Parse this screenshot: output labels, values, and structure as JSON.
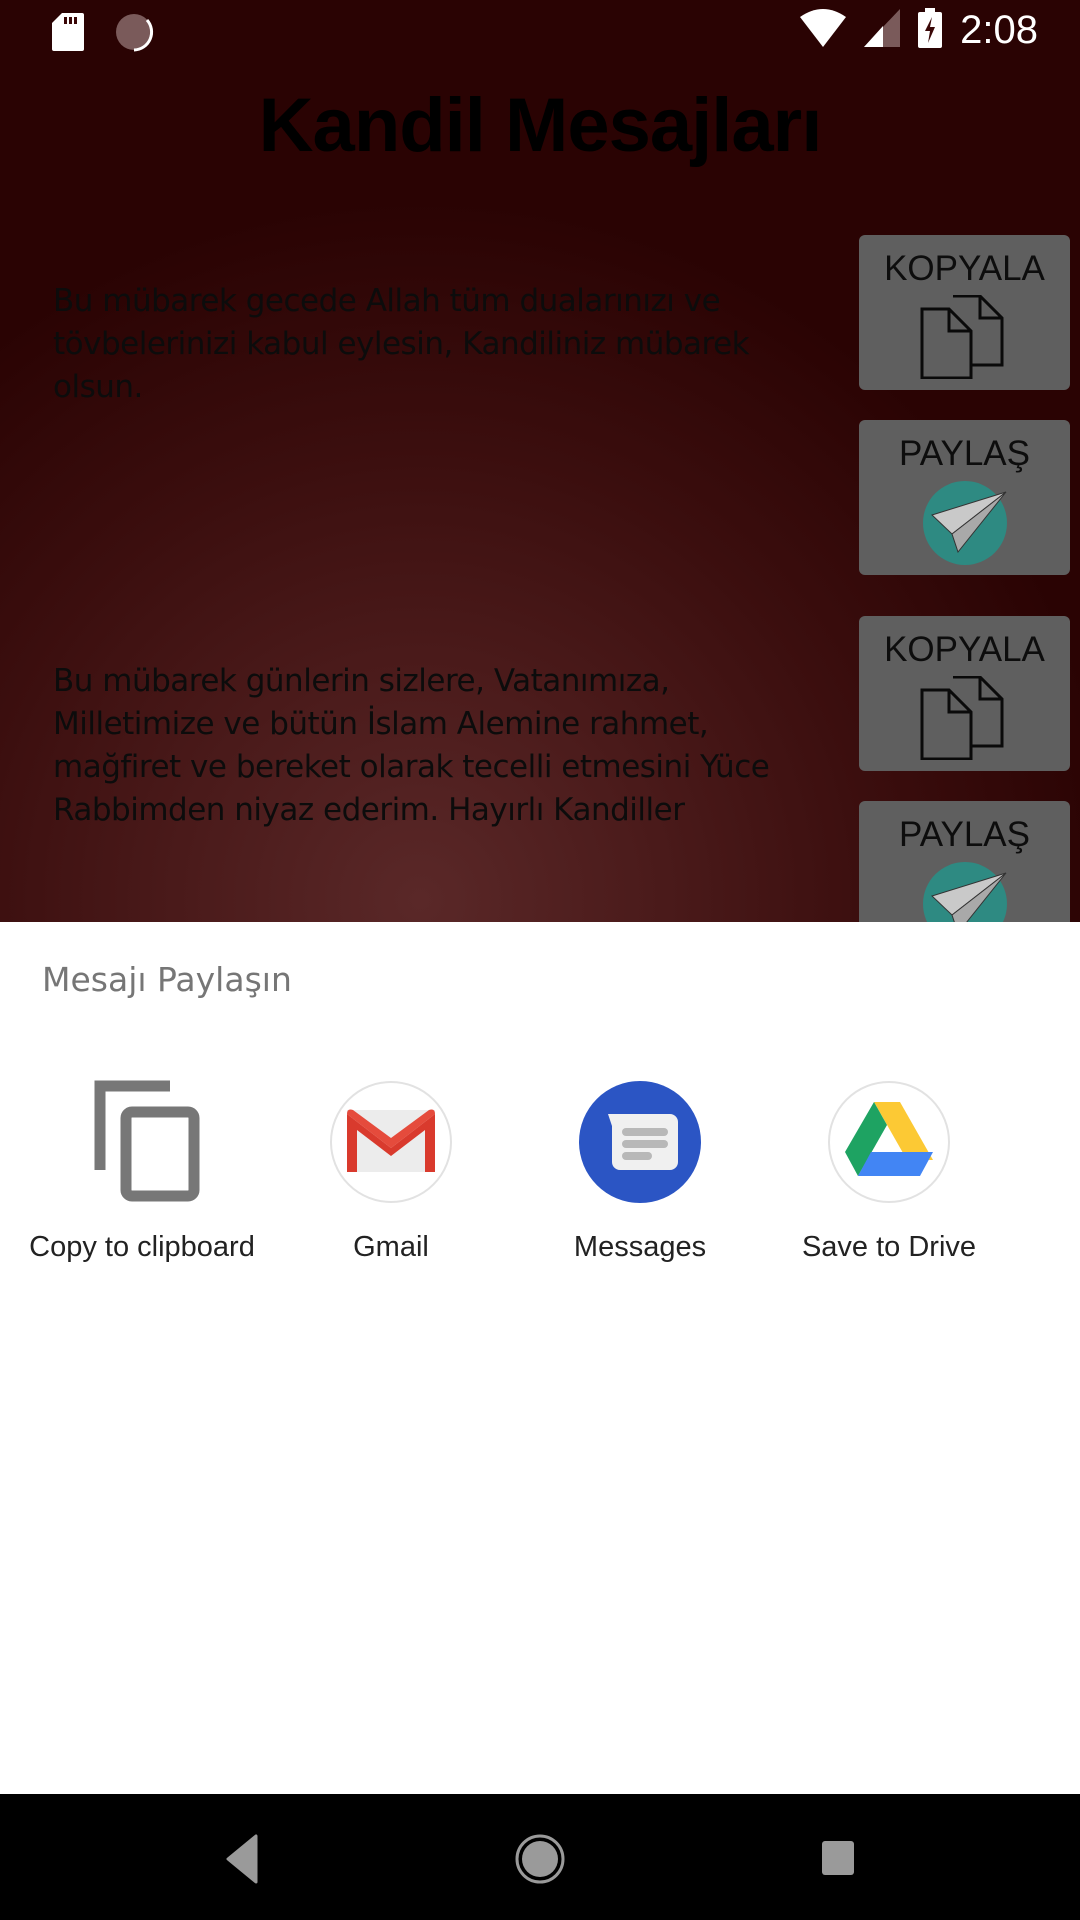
{
  "status_bar": {
    "time": "2:08",
    "left_icons": [
      "sd-card-icon",
      "sync-progress-icon"
    ],
    "right_icons": [
      "wifi-icon",
      "cell-signal-icon",
      "battery-charging-icon"
    ]
  },
  "app": {
    "title": "Kandil Mesajları",
    "messages": [
      {
        "text": "Bu mübarek gecede Allah tüm dualarınızı ve tövbelerinizi kabul eylesin, Kandiliniz mübarek olsun.",
        "copy_label": "KOPYALA",
        "share_label": "PAYLAŞ"
      },
      {
        "text": "Bu mübarek günlerin sizlere, Vatanımıza, Milletimize ve bütün İslam Alemine rahmet, mağfiret ve bereket olarak tecelli etmesini Yüce Rabbimden niyaz ederim. Hayırlı Kandiller",
        "copy_label": "KOPYALA",
        "share_label": "PAYLAŞ"
      }
    ]
  },
  "share_sheet": {
    "title": "Mesajı Paylaşın",
    "targets": [
      {
        "label": "Copy to clipboard",
        "icon": "copy-icon"
      },
      {
        "label": "Gmail",
        "icon": "gmail-icon"
      },
      {
        "label": "Messages",
        "icon": "messages-icon"
      },
      {
        "label": "Save to Drive",
        "icon": "drive-icon"
      }
    ]
  },
  "nav_bar": {
    "buttons": [
      "back",
      "home",
      "recents"
    ]
  }
}
